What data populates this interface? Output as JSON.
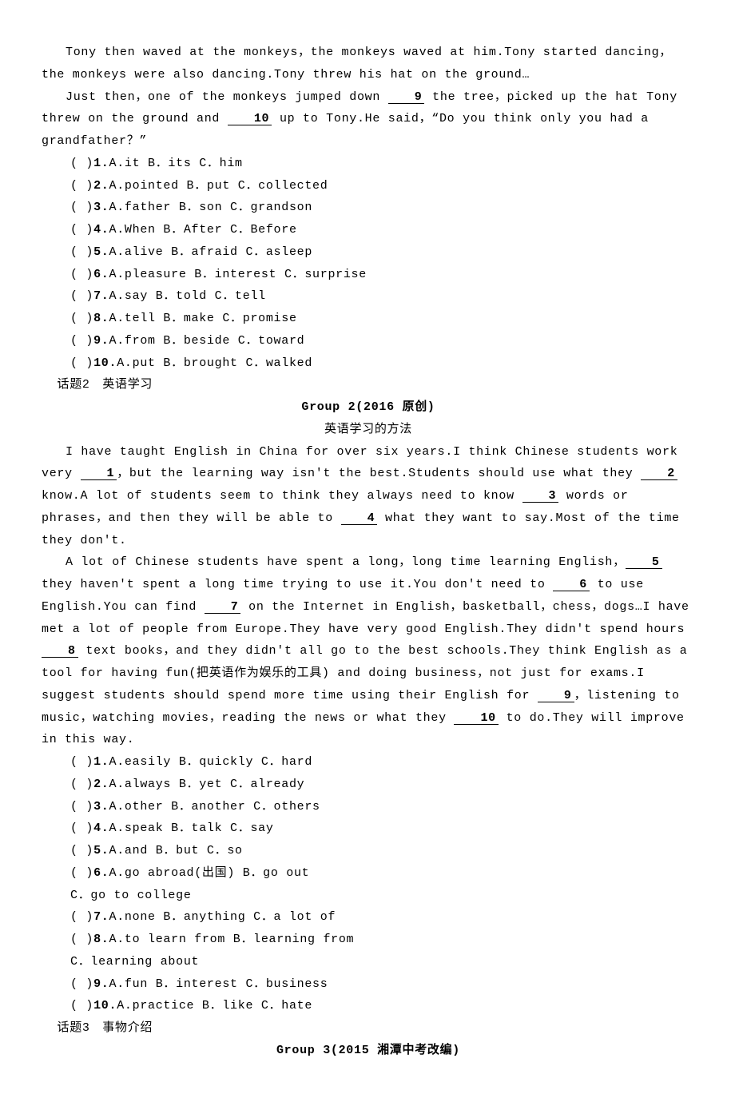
{
  "intro": {
    "p1_a": "Tony then waved at the monkeys，the monkeys waved at him.Tony started dancing，the monkeys were also dancing.Tony threw his hat on the ground…",
    "p2_a": "Just then，one of the monkeys jumped down ",
    "blank9": "9",
    "p2_b": " the tree，picked up the hat Tony threw on the ground and ",
    "blank10": "10",
    "p2_c": " up to Tony.He said，“Do you think only you had a grandfather？”"
  },
  "q1": [
    {
      "pre": "(    )",
      "num": "1.",
      "opts": "A.it           B．its         C．him"
    },
    {
      "pre": "(    )",
      "num": "2.",
      "opts": "A.pointed  B．put  C．collected"
    },
    {
      "pre": "(    )",
      "num": "3.",
      "opts": "A.father  B．son  C．grandson"
    },
    {
      "pre": "(    )",
      "num": "4.",
      "opts": "A.When  B．After  C．Before"
    },
    {
      "pre": "(    )",
      "num": "5.",
      "opts": "A.alive  B．afraid  C．asleep"
    },
    {
      "pre": "(    )",
      "num": "6.",
      "opts": "A.pleasure  B．interest  C．surprise"
    },
    {
      "pre": "(    )",
      "num": "7.",
      "opts": "A.say  B．told  C．tell"
    },
    {
      "pre": "(    )",
      "num": "8.",
      "opts": "A.tell  B．make  C．promise"
    },
    {
      "pre": "(    )",
      "num": "9.",
      "opts": "A.from  B．beside  C．toward"
    },
    {
      "pre": "(    )",
      "num": "10.",
      "opts": "A.put  B．brought  C．walked"
    }
  ],
  "topic2": "话题2　英语学习",
  "group2_title": "Group 2(2016 原创)",
  "group2_sub": "英语学习的方法",
  "pass2": {
    "p1": {
      "a": "I have taught English in China for over six years.I think Chinese students work very ",
      "b1": "1",
      "c": "，but the learning way isn't the best.Students should use what they ",
      "b2": "2",
      "d": " know.A lot of students seem to think they always need to know ",
      "b3": "3",
      "e": " words or phrases，and then they will be able to ",
      "b4": "4",
      "f": " what they want to say.Most of the time they don't."
    },
    "p2": {
      "a": "A lot of Chinese students have spent a long，long time learning English，",
      "b5": "5",
      "c": " they haven't spent a long time trying to use it.You don't need to ",
      "b6": "6",
      "d": " to use English.You can find ",
      "b7": "7",
      "e": " on the Internet in English，basketball，chess，dogs…I have met a lot of people from Europe.They have very good English.They didn't spend hours ",
      "b8": "8",
      "f": " text books，and they didn't all go to the best schools.They think English as a tool for having fun(把英语作为娱乐的工具) and doing business，not just for exams.I suggest students should spend more time using their English for ",
      "b9": "9",
      "g": "，listening to music，watching movies，reading the news or what they ",
      "b10": "10",
      "h": " to do.They will improve in this way."
    }
  },
  "q2": [
    {
      "pre": "(    )",
      "num": "1.",
      "opts": "A.easily  B．quickly  C．hard"
    },
    {
      "pre": "(    )",
      "num": "2.",
      "opts": "A.always  B．yet  C．already"
    },
    {
      "pre": "(    )",
      "num": "3.",
      "opts": "A.other  B．another  C．others"
    },
    {
      "pre": "(    )",
      "num": "4.",
      "opts": "A.speak  B．talk  C．say"
    },
    {
      "pre": "(    )",
      "num": "5.",
      "opts": "A.and  B．but  C．so"
    },
    {
      "pre": "(    )",
      "num": "6.",
      "opts": "A.go abroad(出国)       B．go out"
    },
    {
      "sub": true,
      "opts": "C．go to college"
    },
    {
      "pre": "(    )",
      "num": "7.",
      "opts": "A.none  B．anything  C．a lot of"
    },
    {
      "pre": "(    )",
      "num": "8.",
      "opts": "A.to learn from     B．learning from"
    },
    {
      "sub": true,
      "opts": "C．learning about"
    },
    {
      "pre": "(    )",
      "num": "9.",
      "opts": "A.fun  B．interest  C．business"
    },
    {
      "pre": "(    )",
      "num": "10.",
      "opts": "A.practice  B．like  C．hate"
    }
  ],
  "topic3": "话题3　事物介绍",
  "group3_title": "Group 3(2015 湘潭中考改编)"
}
